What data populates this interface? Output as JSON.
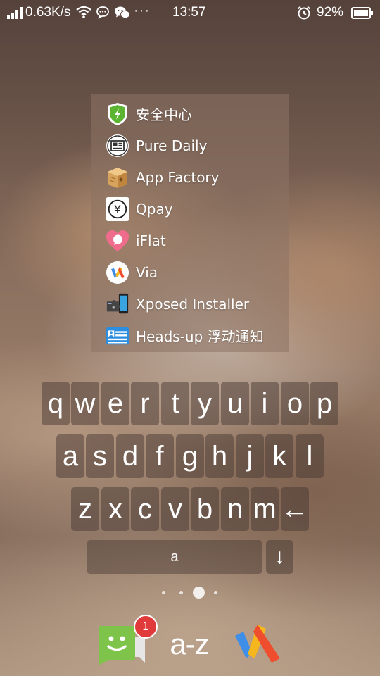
{
  "status_bar": {
    "net_speed": "0.63K/s",
    "time": "13:57",
    "battery": "92%",
    "icons": [
      "signal-icon",
      "wifi-icon",
      "chat-bubble-icon",
      "wechat-icon",
      "more-icon",
      "alarm-icon",
      "battery-icon"
    ]
  },
  "app_list": [
    {
      "label": "安全中心",
      "icon": "shield-icon"
    },
    {
      "label": "Pure Daily",
      "icon": "newspaper-icon"
    },
    {
      "label": "App Factory",
      "icon": "box-icon"
    },
    {
      "label": "Qpay",
      "icon": "yen-icon"
    },
    {
      "label": "iFlat",
      "icon": "heart-chat-icon"
    },
    {
      "label": "Via",
      "icon": "via-icon"
    },
    {
      "label": "Xposed Installer",
      "icon": "puzzle-icon"
    },
    {
      "label": "Heads-up 浮动通知",
      "icon": "id-card-icon"
    }
  ],
  "keyboard": {
    "row1": [
      "q",
      "w",
      "e",
      "r",
      "t",
      "y",
      "u",
      "i",
      "o",
      "p"
    ],
    "row2": [
      "a",
      "s",
      "d",
      "f",
      "g",
      "h",
      "j",
      "k",
      "l"
    ],
    "row3": [
      "z",
      "x",
      "c",
      "v",
      "b",
      "n",
      "m",
      "←"
    ],
    "input_value": "a",
    "down_key": "↓"
  },
  "pager": {
    "pages": 4,
    "current": 3
  },
  "dock": {
    "messages_badge": "1",
    "az_label": "a-z",
    "icons": [
      "messages-icon",
      "az-icon",
      "launcher-icon"
    ]
  },
  "colors": {
    "accent_green": "#7ec34a",
    "badge_red": "#e03a3a"
  }
}
